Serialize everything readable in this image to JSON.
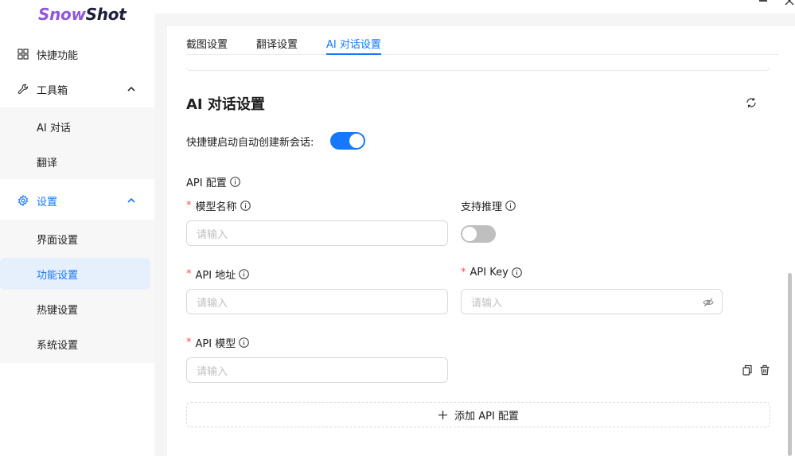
{
  "app": {
    "logo_part1": "Snow",
    "logo_part2": "Shot"
  },
  "sidebar": {
    "items": [
      {
        "label": "快捷功能",
        "icon": "grid-icon"
      },
      {
        "label": "工具箱",
        "icon": "wrench-icon",
        "expanded": true,
        "children": [
          {
            "label": "AI 对话"
          },
          {
            "label": "翻译"
          }
        ]
      },
      {
        "label": "设置",
        "icon": "gear-icon",
        "expanded": true,
        "active": true,
        "children": [
          {
            "label": "界面设置"
          },
          {
            "label": "功能设置",
            "selected": true
          },
          {
            "label": "热键设置"
          },
          {
            "label": "系统设置"
          }
        ]
      }
    ]
  },
  "tabs": [
    {
      "label": "截图设置"
    },
    {
      "label": "翻译设置"
    },
    {
      "label": "AI 对话设置",
      "active": true
    }
  ],
  "section": {
    "title": "AI 对话设置",
    "shortcut_new_chat_label": "快捷键启动自动创建新会话:",
    "shortcut_new_chat_on": true,
    "api_config_label": "API 配置",
    "model_name_label": "模型名称",
    "model_name_placeholder": "请输入",
    "support_reasoning_label": "支持推理",
    "support_reasoning_on": false,
    "api_address_label": "API 地址",
    "api_address_placeholder": "请输入",
    "api_key_label": "API Key",
    "api_key_placeholder": "请输入",
    "api_model_label": "API 模型",
    "api_model_placeholder": "请输入",
    "add_api_config_label": "添加 API 配置"
  },
  "colors": {
    "accent": "#1677ff",
    "required": "#ff4d4f",
    "logo_purple": "#9256d9"
  }
}
